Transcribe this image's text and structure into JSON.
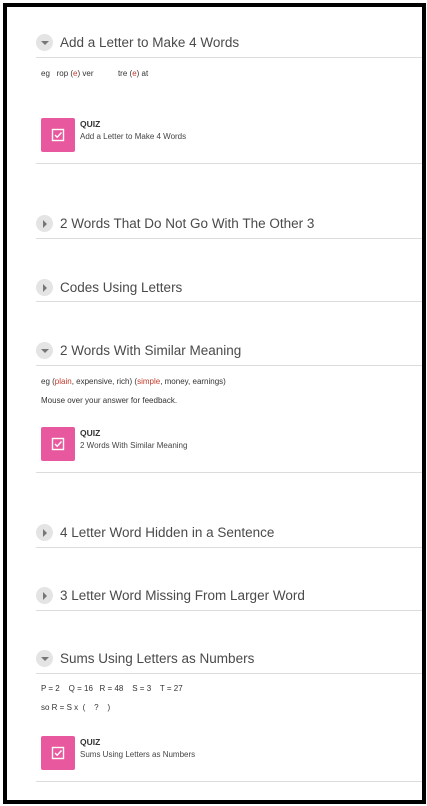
{
  "sections": [
    {
      "title": "Add a Letter to Make 4 Words",
      "expanded": true,
      "example_prefix": "eg",
      "example": {
        "w1a": "rop",
        "w1l": "e",
        "w1b": "ver",
        "w2a": "tre",
        "w2l": "e",
        "w2b": "at"
      },
      "quiz": {
        "kind": "QUIZ",
        "name": "Add a Letter to Make 4 Words"
      }
    },
    {
      "title": "2 Words That Do Not Go With The Other 3",
      "expanded": false
    },
    {
      "title": "Codes Using Letters",
      "expanded": false
    },
    {
      "title": "2 Words With Similar Meaning",
      "expanded": true,
      "example": {
        "prefix": "eg (",
        "a": "plain",
        "b": ", expensive, rich) (",
        "c": "simple",
        "d": ", money, earnings)"
      },
      "note": "Mouse over your answer for feedback.",
      "quiz": {
        "kind": "QUIZ",
        "name": "2 Words With Similar Meaning"
      }
    },
    {
      "title": "4 Letter Word Hidden in a Sentence",
      "expanded": false
    },
    {
      "title": "3 Letter Word Missing From Larger Word",
      "expanded": false
    },
    {
      "title": "Sums Using Letters as Numbers",
      "expanded": true,
      "line1": "P = 2    Q = 16   R = 48    S = 3    T = 27",
      "line2": "so R = S x  (    ?    )",
      "quiz": {
        "kind": "QUIZ",
        "name": "Sums Using Letters as Numbers"
      }
    }
  ],
  "colors": {
    "quiz_icon": "#e8589f",
    "highlight": "#c0392b",
    "toggle": "#e4e4e4"
  },
  "icons": {
    "expanded": "chevron-down-icon",
    "collapsed": "chevron-right-icon",
    "quiz": "quiz-checkbox-icon"
  }
}
